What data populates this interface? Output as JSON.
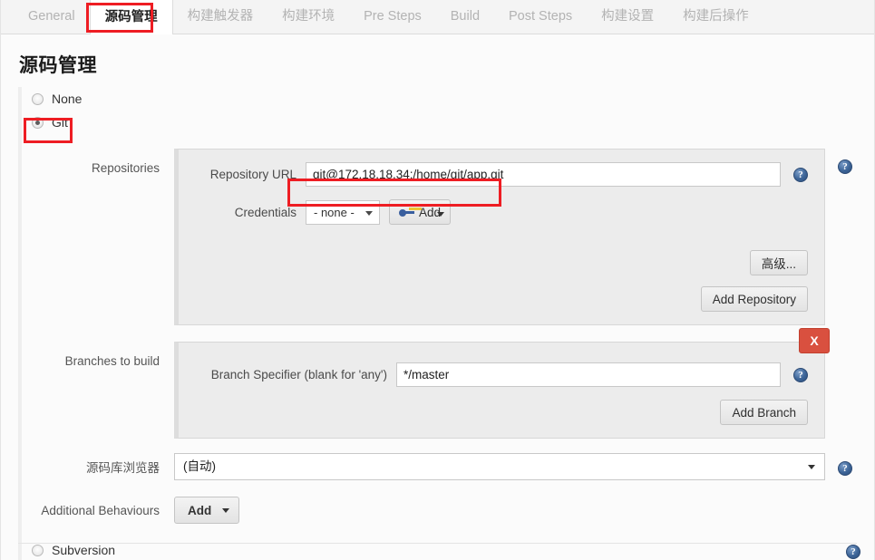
{
  "tabs": [
    {
      "label": "General",
      "active": false
    },
    {
      "label": "源码管理",
      "active": true,
      "highlighted": true
    },
    {
      "label": "构建触发器",
      "active": false
    },
    {
      "label": "构建环境",
      "active": false
    },
    {
      "label": "Pre Steps",
      "active": false
    },
    {
      "label": "Build",
      "active": false
    },
    {
      "label": "Post Steps",
      "active": false
    },
    {
      "label": "构建设置",
      "active": false
    },
    {
      "label": "构建后操作",
      "active": false
    }
  ],
  "page": {
    "title": "源码管理"
  },
  "scm_options": [
    {
      "label": "None",
      "selected": false
    },
    {
      "label": "Git",
      "selected": true,
      "highlighted": true
    },
    {
      "label": "Subversion",
      "selected": false
    }
  ],
  "repositories": {
    "section_label": "Repositories",
    "repository_url": {
      "label": "Repository URL",
      "value": "git@172.18.18.34:/home/git/app.git",
      "highlighted": true
    },
    "credentials": {
      "label": "Credentials",
      "selected": "- none -",
      "add_label": "Add"
    },
    "advanced_button": "高级...",
    "add_repository_button": "Add Repository"
  },
  "branches": {
    "section_label": "Branches to build",
    "branch_specifier": {
      "label": "Branch Specifier (blank for 'any')",
      "value": "*/master"
    },
    "delete_label": "X",
    "add_branch_button": "Add Branch"
  },
  "repository_browser": {
    "label": "源码库浏览器",
    "selected": "(自动)"
  },
  "additional_behaviours": {
    "label": "Additional Behaviours",
    "add_label": "Add"
  },
  "icons": {
    "help": "?",
    "key": "key-icon",
    "caret": "▼"
  },
  "colors": {
    "annotation_red": "#ee1d23",
    "delete_red": "#d9503f",
    "help_blue": "#3c6497"
  }
}
